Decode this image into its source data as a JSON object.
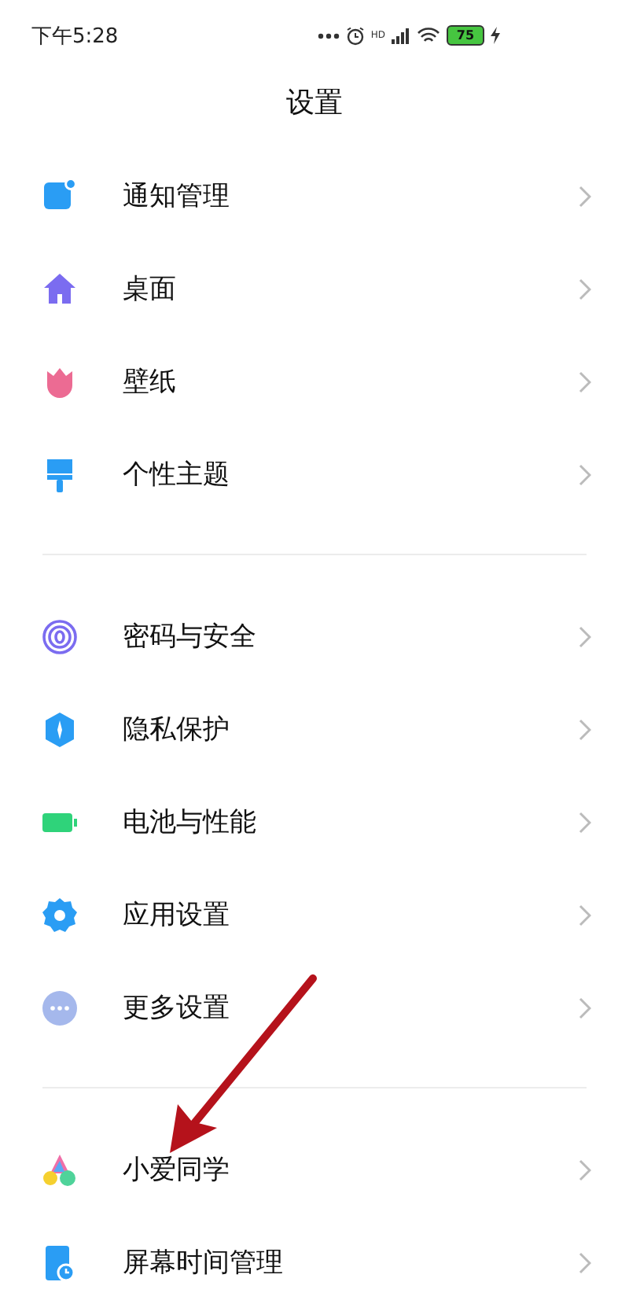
{
  "status_bar": {
    "time": "下午5:28",
    "signal_label": "HD",
    "battery_percent": "75",
    "charging": true
  },
  "title": "设置",
  "groups": [
    {
      "items": [
        {
          "kind": "notify",
          "label": "通知管理"
        },
        {
          "kind": "home",
          "label": "桌面"
        },
        {
          "kind": "tulip",
          "label": "壁纸"
        },
        {
          "kind": "brush",
          "label": "个性主题"
        }
      ]
    },
    {
      "items": [
        {
          "kind": "fingerprint",
          "label": "密码与安全"
        },
        {
          "kind": "shield",
          "label": "隐私保护"
        },
        {
          "kind": "battery",
          "label": "电池与性能"
        },
        {
          "kind": "gear",
          "label": "应用设置"
        },
        {
          "kind": "more",
          "label": "更多设置"
        }
      ]
    },
    {
      "items": [
        {
          "kind": "assistant",
          "label": "小爱同学"
        },
        {
          "kind": "screentime",
          "label": "屏幕时间管理"
        }
      ]
    }
  ],
  "annotation": {
    "kind": "arrow"
  }
}
